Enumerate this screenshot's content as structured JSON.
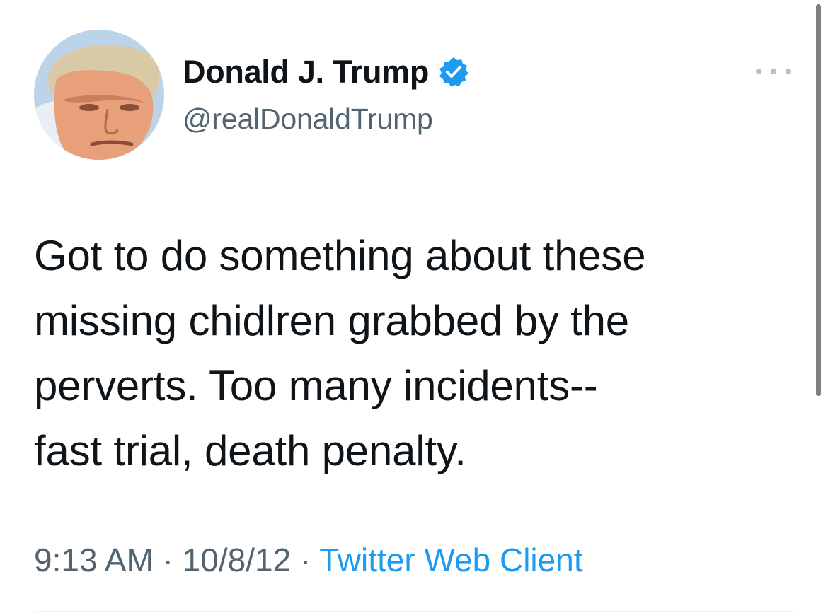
{
  "author": {
    "display_name": "Donald J. Trump",
    "handle": "@realDonaldTrump",
    "verified": true,
    "avatar_icon": "profile-photo"
  },
  "tweet": {
    "text": "Got to do something about these\nmissing chidlren grabbed by the\nperverts. Too many incidents--\nfast trial, death penalty."
  },
  "meta": {
    "time": "9:13 AM",
    "separator": "·",
    "date": "10/8/12",
    "source": "Twitter Web Client"
  },
  "colors": {
    "text_primary": "#0f1419",
    "text_secondary": "#536471",
    "link_blue": "#1d9bf0",
    "verified_blue": "#1d9bf0"
  },
  "icons": {
    "more": "more-horizontal-icon",
    "verified": "verified-badge-icon"
  }
}
